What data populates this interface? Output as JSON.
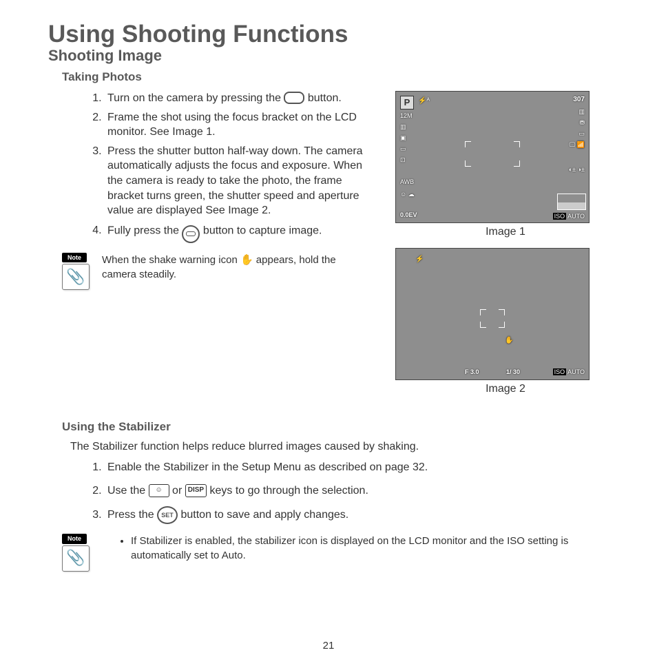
{
  "page_number": "21",
  "title": "Using Shooting Functions",
  "section1": {
    "heading": "Shooting Image",
    "sub": "Taking Photos",
    "steps": [
      {
        "pre": "Turn on the camera by pressing the ",
        "post": " button."
      },
      {
        "text": "Frame the shot using the focus bracket on the LCD monitor. See Image 1."
      },
      {
        "text": "Press the shutter button half-way down. The camera automatically adjusts the focus and exposure. When the camera is ready to take the photo, the frame bracket turns green, the shutter speed and aperture value are displayed See Image 2."
      },
      {
        "pre": "Fully press the ",
        "post": " button to capture image."
      }
    ],
    "note_label": "Note",
    "note": {
      "pre": "When the shake warning icon ",
      "post": " appears, hold the camera steadily."
    },
    "image1_caption": "Image 1",
    "image2_caption": "Image 2",
    "lcd1": {
      "mode": "P",
      "flash": "⚡ᴬ",
      "shots": "307",
      "size": "12M",
      "awb": "AWB",
      "ev": "0.0EV",
      "iso_label": "ISO",
      "iso": "AUTO"
    },
    "lcd2": {
      "flash": "⚡",
      "fnum": "F 3.0",
      "shutter": "1/ 30",
      "iso_label": "ISO",
      "iso": "AUTO"
    }
  },
  "section2": {
    "heading": "Using the Stabilizer",
    "intro": "The Stabilizer function helps reduce blurred images caused by shaking.",
    "steps": [
      {
        "text": "Enable the Stabilizer in the Setup Menu as described on page 32."
      },
      {
        "pre": "Use the ",
        "mid": " or ",
        "post": " keys to go through the selection.",
        "key1": "☺",
        "key2": "DISP"
      },
      {
        "pre": "Press the ",
        "post": " button to save and apply changes.",
        "key": "SET"
      }
    ],
    "note_label": "Note",
    "note": "If Stabilizer is enabled, the stabilizer icon is displayed on the LCD monitor and the ISO setting is automatically set to Auto."
  }
}
